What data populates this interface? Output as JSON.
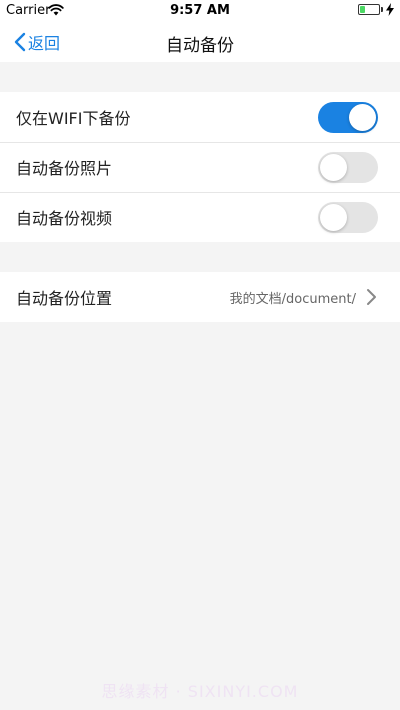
{
  "status_bar": {
    "carrier": "Carrier",
    "time": "9:57 AM",
    "battery_level": 0.3
  },
  "nav": {
    "back_label": "返回",
    "title": "自动备份"
  },
  "settings": {
    "wifi_only": {
      "label": "仅在WIFI下备份",
      "enabled": true
    },
    "auto_photos": {
      "label": "自动备份照片",
      "enabled": false
    },
    "auto_videos": {
      "label": "自动备份视频",
      "enabled": false
    },
    "location": {
      "label": "自动备份位置",
      "value": "我的文档/document/"
    }
  },
  "watermark": "思缘素材 · SIXINYI.COM",
  "colors": {
    "accent": "#1a82e2",
    "toggle_off": "#e4e4e4",
    "background": "#f4f4f4"
  }
}
